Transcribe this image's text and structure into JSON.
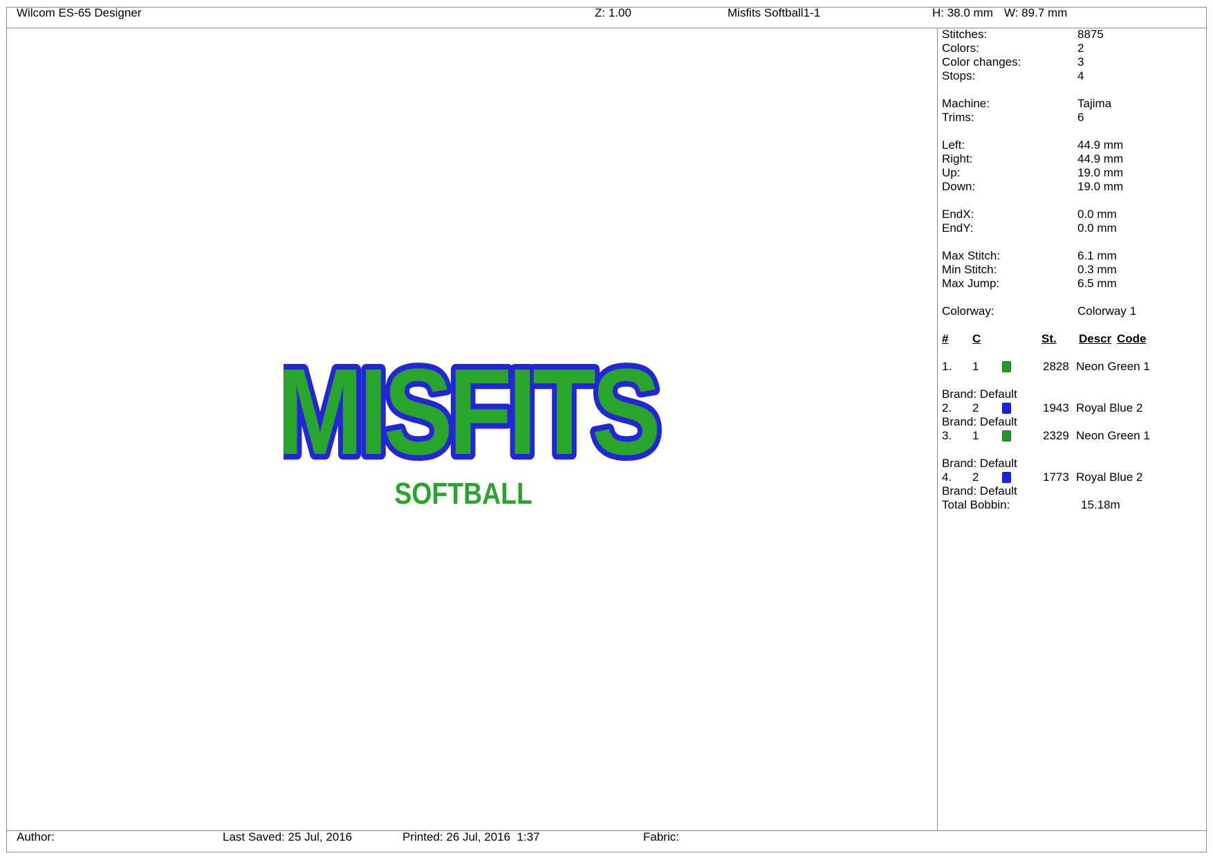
{
  "header": {
    "app_title": "Wilcom ES-65 Designer",
    "zoom": "Z: 1.00",
    "design_name": "Misfits Softball1-1",
    "height": "H: 38.0 mm",
    "width": "W: 89.7 mm"
  },
  "stats": {
    "stitches_label": "Stitches:",
    "stitches_value": "8875",
    "colors_label": "Colors:",
    "colors_value": "2",
    "color_changes_label": "Color changes:",
    "color_changes_value": "3",
    "stops_label": "Stops:",
    "stops_value": "4",
    "machine_label": "Machine:",
    "machine_value": "Tajima",
    "trims_label": "Trims:",
    "trims_value": "6",
    "left_label": "Left:",
    "left_value": "44.9 mm",
    "right_label": "Right:",
    "right_value": "44.9 mm",
    "up_label": "Up:",
    "up_value": "19.0 mm",
    "down_label": "Down:",
    "down_value": "19.0 mm",
    "endx_label": "EndX:",
    "endx_value": "0.0 mm",
    "endy_label": "EndY:",
    "endy_value": "0.0 mm",
    "max_stitch_label": "Max Stitch:",
    "max_stitch_value": "6.1 mm",
    "min_stitch_label": "Min Stitch:",
    "min_stitch_value": "0.3 mm",
    "max_jump_label": "Max Jump:",
    "max_jump_value": "6.5 mm",
    "colorway_label": "Colorway:",
    "colorway_value": "Colorway 1"
  },
  "color_table": {
    "headers": {
      "num": "#",
      "c": "C",
      "st": "St.",
      "descr": "Descr",
      "code": "Code"
    },
    "rows": [
      {
        "num": "1.",
        "c": "1",
        "color": "#1f9a22",
        "st": "2828",
        "descr": "Neon Green 1",
        "brand": "Brand: Default"
      },
      {
        "num": "2.",
        "c": "2",
        "color": "#1a22e6",
        "st": "1943",
        "descr": "Royal Blue 2",
        "brand": "Brand: Default"
      },
      {
        "num": "3.",
        "c": "1",
        "color": "#1f9a22",
        "st": "2329",
        "descr": "Neon Green 1",
        "brand": "Brand: Default"
      },
      {
        "num": "4.",
        "c": "2",
        "color": "#1a22e6",
        "st": "1773",
        "descr": "Royal Blue 2",
        "brand": "Brand: Default"
      }
    ],
    "total_bobbin_label": "Total Bobbin:",
    "total_bobbin_value": "15.18m"
  },
  "design": {
    "title_text": "MISFITS",
    "subtitle_text": "SOFTBALL",
    "fill_color": "#2aa52c",
    "outline_color": "#2326d6"
  },
  "footer": {
    "author": "Author:",
    "last_saved": "Last Saved: 25 Jul, 2016",
    "printed": "Printed: 26 Jul, 2016  1:37",
    "fabric": "Fabric:"
  }
}
